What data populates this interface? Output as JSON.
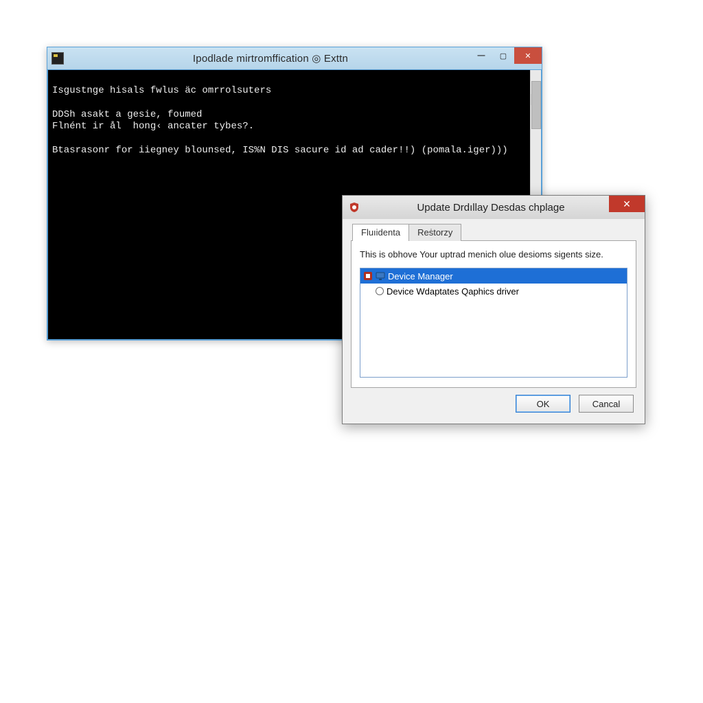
{
  "console": {
    "title": "Ipodlade mirtromffication ◎ Exttn",
    "lines": [
      "Isgustnge hisals fwlus äc omrrolsuters",
      "",
      "DDSh asakt a gesie, foumed",
      "Flnént ir ål  hong‹ ancater tybes?.",
      "",
      "Btasrasonr for iiegney blounsed, IS%N DIS sacure id ad cader!!) (pomala.iger)))"
    ],
    "scroll": {
      "up": "▲",
      "down": "▼"
    }
  },
  "dialog": {
    "title": "Update Drdıllay Desdas chplage",
    "tabs": [
      {
        "label": "Fluıidenta",
        "active": true
      },
      {
        "label": "Reṡtorzy",
        "active": false
      }
    ],
    "description": "This is obhove Your uptrad menich olue desioms sigents size.",
    "list": [
      {
        "kind": "header",
        "label": "Device Manager",
        "selected": true
      },
      {
        "kind": "radio",
        "label": "Device Wdaptates Qaphics driver",
        "selected": false
      }
    ],
    "buttons": {
      "ok": "OK",
      "cancel": "Cancal"
    }
  }
}
